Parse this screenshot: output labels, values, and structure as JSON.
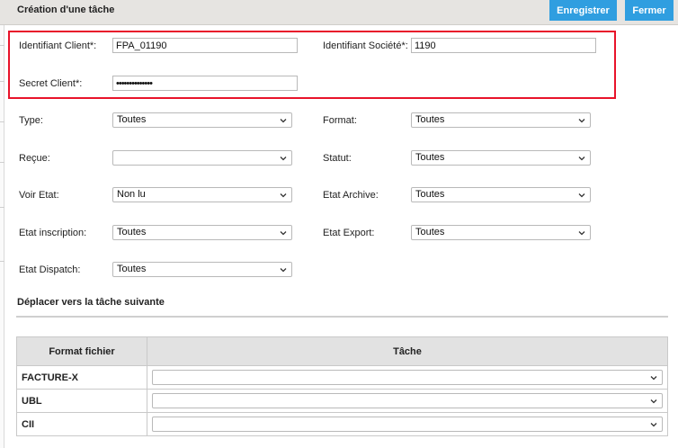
{
  "dialog": {
    "title": "Création d'une tâche",
    "save_label": "Enregistrer",
    "close_label": "Fermer"
  },
  "credentials": {
    "client_id_label": "Identifiant Client*:",
    "client_id_value": "FPA_01190",
    "company_id_label": "Identifiant Société*:",
    "company_id_value": "1190",
    "client_secret_label": "Secret Client*:",
    "client_secret_value": "••••••••••••••"
  },
  "filters": {
    "type": {
      "label": "Type:",
      "value": "Toutes"
    },
    "format": {
      "label": "Format:",
      "value": "Toutes"
    },
    "recue": {
      "label": "Reçue:",
      "value": ""
    },
    "statut": {
      "label": "Statut:",
      "value": "Toutes"
    },
    "voir_etat": {
      "label": "Voir Etat:",
      "value": "Non lu"
    },
    "etat_archive": {
      "label": "Etat Archive:",
      "value": "Toutes"
    },
    "etat_inscription": {
      "label": "Etat inscription:",
      "value": "Toutes"
    },
    "etat_export": {
      "label": "Etat Export:",
      "value": "Toutes"
    },
    "etat_dispatch": {
      "label": "Etat Dispatch:",
      "value": "Toutes"
    }
  },
  "next_task": {
    "section_title": "Déplacer vers la tâche suivante",
    "columns": [
      "Format fichier",
      "Tâche"
    ],
    "rows": [
      {
        "format": "FACTURE-X",
        "task": ""
      },
      {
        "format": "UBL",
        "task": ""
      },
      {
        "format": "CII",
        "task": ""
      }
    ]
  },
  "colors": {
    "accent": "#2f9ee0",
    "highlight": "#e8132a",
    "titlebar": "#e6e4e1"
  }
}
